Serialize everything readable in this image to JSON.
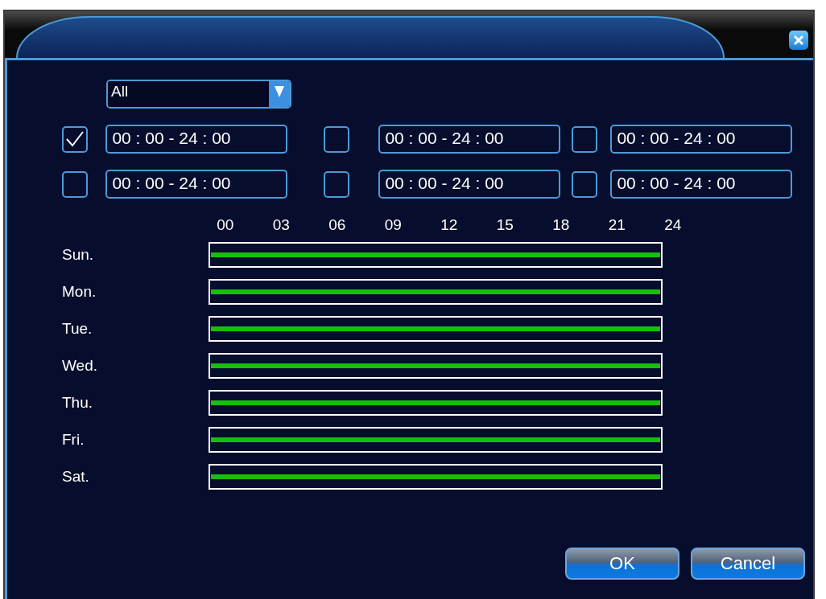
{
  "filter": {
    "value": "All"
  },
  "periods": [
    {
      "checked": true,
      "value": "00 : 00 - 24 : 00"
    },
    {
      "checked": false,
      "value": "00 : 00 - 24 : 00"
    },
    {
      "checked": false,
      "value": "00 : 00 - 24 : 00"
    },
    {
      "checked": false,
      "value": "00 : 00 - 24 : 00"
    },
    {
      "checked": false,
      "value": "00 : 00 - 24 : 00"
    },
    {
      "checked": false,
      "value": "00 : 00 - 24 : 00"
    }
  ],
  "hours": [
    "00",
    "03",
    "06",
    "09",
    "12",
    "15",
    "18",
    "21",
    "24"
  ],
  "days": [
    {
      "label": "Sun.",
      "level": 1
    },
    {
      "label": "Mon.",
      "level": 1
    },
    {
      "label": "Tue.",
      "level": 1
    },
    {
      "label": "Wed.",
      "level": 1
    },
    {
      "label": "Thu.",
      "level": 1
    },
    {
      "label": "Fri.",
      "level": 1
    },
    {
      "label": "Sat.",
      "level": 1
    }
  ],
  "buttons": [
    "OK",
    "Cancel"
  ]
}
